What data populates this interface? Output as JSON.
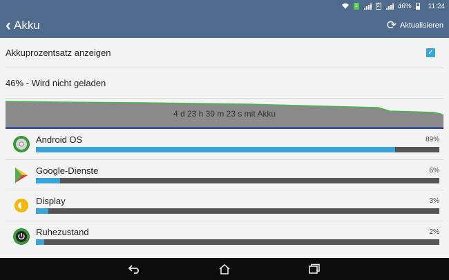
{
  "status_bar": {
    "battery_percent": "46%",
    "time": "11:24"
  },
  "app_bar": {
    "title": "Akku",
    "refresh_label": "Aktualisieren"
  },
  "settings": {
    "show_percentage_label": "Akkuprozentsatz anzeigen",
    "show_percentage_checked": true
  },
  "battery": {
    "status_text": "46% - Wird nicht geladen",
    "graph_label": "4 d 23 h 39 m 23 s mit Akku"
  },
  "usage": [
    {
      "name": "Android OS",
      "percent_label": "89%",
      "percent": 89,
      "icon": "android-os-icon"
    },
    {
      "name": "Google-Dienste",
      "percent_label": "6%",
      "percent": 6,
      "icon": "google-play-services-icon"
    },
    {
      "name": "Display",
      "percent_label": "3%",
      "percent": 3,
      "icon": "display-brightness-icon"
    },
    {
      "name": "Ruhezustand",
      "percent_label": "2%",
      "percent": 2,
      "icon": "idle-power-icon"
    }
  ],
  "colors": {
    "app_bar": "#4e6b8e",
    "accent": "#3aa4dd",
    "graph_fill": "#8a8a8a",
    "graph_line": "#3fbf3f"
  }
}
